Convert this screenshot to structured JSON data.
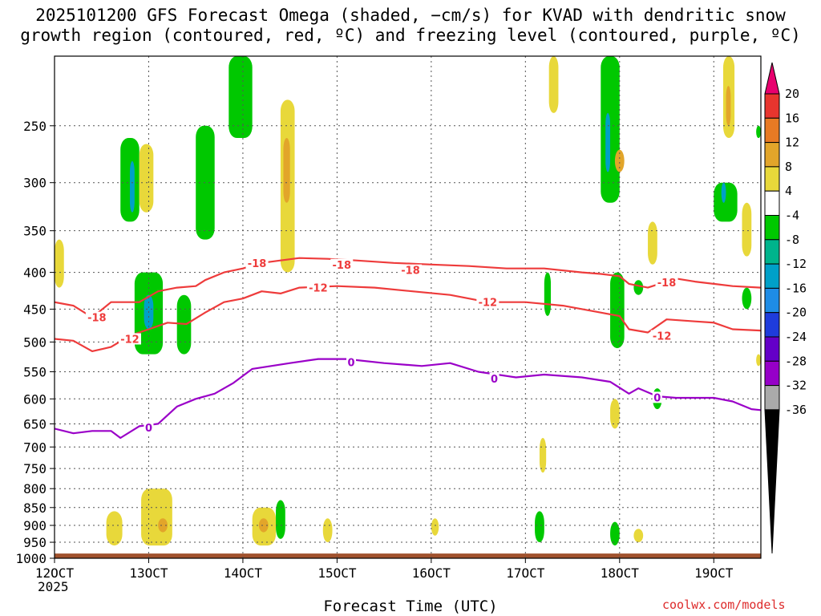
{
  "title_line1": "2025101200 GFS Forecast Omega (shaded, −cm/s) for KVAD with dendritic snow",
  "title_line2": "growth region (contoured, red, ºC) and freezing level (contoured, purple, ºC)",
  "xlabel": "Forecast Time (UTC)",
  "x_year_label": "2025",
  "credit": "coolwx.com/models",
  "chart_data": {
    "type": "time-height cross-section",
    "title": "2025101200 GFS Forecast Omega (shaded, −cm/s) for KVAD with dendritic snow growth region (contoured, red, ºC) and freezing level (contoured, purple, ºC)",
    "xlabel": "Forecast Time (UTC)",
    "ylabel": "",
    "x_ticks": [
      "12OCT",
      "13OCT",
      "14OCT",
      "15OCT",
      "16OCT",
      "17OCT",
      "18OCT",
      "19OCT"
    ],
    "x_range_days": [
      12,
      19.5
    ],
    "y_ticks": [
      250,
      300,
      350,
      400,
      450,
      500,
      550,
      600,
      650,
      700,
      750,
      800,
      850,
      900,
      950,
      1000
    ],
    "y_range_hpa": [
      200,
      1000
    ],
    "y_scale": "log-pressure (reversed)",
    "grid": true,
    "colorbar": {
      "labels": [
        20,
        16,
        12,
        8,
        4,
        -4,
        -8,
        -12,
        -16,
        -20,
        -24,
        -28,
        -32,
        -36
      ],
      "colors": [
        "#e8006e",
        "#e8352e",
        "#e87a24",
        "#e2a52a",
        "#e8d83a",
        "#ffffff",
        "#00c800",
        "#00b48c",
        "#00a0c8",
        "#1e8ce6",
        "#1e3cdc",
        "#6400c8",
        "#9600c8",
        "#aaaaaa",
        "#000000"
      ],
      "units": "−cm/s"
    },
    "contours": [
      {
        "level": -18,
        "color": "#ee3b3b",
        "points": [
          [
            12.0,
            440
          ],
          [
            12.2,
            445
          ],
          [
            12.4,
            462
          ],
          [
            12.6,
            440
          ],
          [
            12.9,
            440
          ],
          [
            13.1,
            425
          ],
          [
            13.3,
            420
          ],
          [
            13.5,
            418
          ],
          [
            13.6,
            410
          ],
          [
            13.8,
            400
          ],
          [
            14.0,
            395
          ],
          [
            14.2,
            388
          ],
          [
            14.4,
            385
          ],
          [
            14.6,
            382
          ],
          [
            14.9,
            383
          ],
          [
            15.2,
            385
          ],
          [
            15.6,
            388
          ],
          [
            16.0,
            390
          ],
          [
            16.4,
            392
          ],
          [
            16.8,
            395
          ],
          [
            17.2,
            395
          ],
          [
            17.6,
            400
          ],
          [
            17.8,
            402
          ],
          [
            18.0,
            405
          ],
          [
            18.1,
            415
          ],
          [
            18.3,
            420
          ],
          [
            18.6,
            408
          ],
          [
            18.8,
            412
          ],
          [
            19.0,
            415
          ],
          [
            19.2,
            418
          ],
          [
            19.5,
            420
          ]
        ]
      },
      {
        "level": -12,
        "color": "#ee3b3b",
        "points": [
          [
            12.0,
            495
          ],
          [
            12.2,
            498
          ],
          [
            12.4,
            515
          ],
          [
            12.6,
            508
          ],
          [
            12.8,
            490
          ],
          [
            13.0,
            480
          ],
          [
            13.2,
            470
          ],
          [
            13.4,
            472
          ],
          [
            13.6,
            455
          ],
          [
            13.8,
            440
          ],
          [
            14.0,
            435
          ],
          [
            14.2,
            425
          ],
          [
            14.4,
            428
          ],
          [
            14.6,
            420
          ],
          [
            15.0,
            418
          ],
          [
            15.4,
            420
          ],
          [
            15.8,
            425
          ],
          [
            16.2,
            430
          ],
          [
            16.6,
            440
          ],
          [
            17.0,
            440
          ],
          [
            17.4,
            445
          ],
          [
            17.8,
            455
          ],
          [
            18.0,
            460
          ],
          [
            18.1,
            480
          ],
          [
            18.3,
            485
          ],
          [
            18.5,
            465
          ],
          [
            18.8,
            468
          ],
          [
            19.0,
            470
          ],
          [
            19.2,
            480
          ],
          [
            19.5,
            482
          ]
        ]
      },
      {
        "level": 0,
        "color": "#9a00c8",
        "points": [
          [
            12.0,
            660
          ],
          [
            12.2,
            670
          ],
          [
            12.4,
            665
          ],
          [
            12.6,
            665
          ],
          [
            12.7,
            680
          ],
          [
            12.9,
            655
          ],
          [
            13.1,
            650
          ],
          [
            13.3,
            615
          ],
          [
            13.5,
            600
          ],
          [
            13.7,
            590
          ],
          [
            13.9,
            570
          ],
          [
            14.1,
            545
          ],
          [
            14.3,
            540
          ],
          [
            14.5,
            535
          ],
          [
            14.8,
            528
          ],
          [
            15.1,
            528
          ],
          [
            15.5,
            535
          ],
          [
            15.9,
            540
          ],
          [
            16.2,
            535
          ],
          [
            16.5,
            550
          ],
          [
            16.9,
            560
          ],
          [
            17.2,
            555
          ],
          [
            17.6,
            560
          ],
          [
            17.9,
            568
          ],
          [
            18.1,
            590
          ],
          [
            18.2,
            580
          ],
          [
            18.4,
            595
          ],
          [
            18.6,
            598
          ],
          [
            19.0,
            598
          ],
          [
            19.2,
            605
          ],
          [
            19.4,
            620
          ],
          [
            19.5,
            622
          ]
        ]
      }
    ],
    "contour_labels": [
      {
        "text": "-18",
        "x": 14.15,
        "p": 388
      },
      {
        "text": "-18",
        "x": 15.05,
        "p": 390
      },
      {
        "text": "-18",
        "x": 15.78,
        "p": 397
      },
      {
        "text": "-18",
        "x": 18.5,
        "p": 413
      },
      {
        "text": "-18",
        "x": 12.45,
        "p": 462
      },
      {
        "text": "-12",
        "x": 14.8,
        "p": 420
      },
      {
        "text": "-12",
        "x": 16.6,
        "p": 440
      },
      {
        "text": "-12",
        "x": 12.8,
        "p": 495
      },
      {
        "text": "-12",
        "x": 18.45,
        "p": 490
      },
      {
        "text": "0",
        "x": 15.15,
        "p": 533
      },
      {
        "text": "0",
        "x": 16.67,
        "p": 562
      },
      {
        "text": "0",
        "x": 13.0,
        "p": 658
      },
      {
        "text": "0",
        "x": 18.4,
        "p": 597
      }
    ],
    "omega_regions": [
      {
        "value": 6,
        "x": [
          12.0,
          12.1
        ],
        "p": [
          360,
          420
        ]
      },
      {
        "value": 6,
        "x": [
          12.55,
          12.72
        ],
        "p": [
          860,
          960
        ]
      },
      {
        "value": -6,
        "x": [
          12.7,
          12.9
        ],
        "p": [
          260,
          340
        ]
      },
      {
        "value": -14,
        "x": [
          12.8,
          12.85
        ],
        "p": [
          280,
          330
        ]
      },
      {
        "value": 6,
        "x": [
          12.9,
          13.05
        ],
        "p": [
          265,
          330
        ]
      },
      {
        "value": -6,
        "x": [
          12.85,
          13.15
        ],
        "p": [
          400,
          520
        ]
      },
      {
        "value": -14,
        "x": [
          12.95,
          13.05
        ],
        "p": [
          430,
          480
        ]
      },
      {
        "value": 6,
        "x": [
          12.92,
          13.25
        ],
        "p": [
          800,
          960
        ]
      },
      {
        "value": 10,
        "x": [
          13.1,
          13.2
        ],
        "p": [
          880,
          920
        ]
      },
      {
        "value": -6,
        "x": [
          13.3,
          13.45
        ],
        "p": [
          430,
          520
        ]
      },
      {
        "value": -6,
        "x": [
          13.5,
          13.7
        ],
        "p": [
          250,
          360
        ]
      },
      {
        "value": -6,
        "x": [
          13.85,
          14.1
        ],
        "p": [
          200,
          260
        ]
      },
      {
        "value": 6,
        "x": [
          14.1,
          14.35
        ],
        "p": [
          850,
          960
        ]
      },
      {
        "value": 10,
        "x": [
          14.17,
          14.27
        ],
        "p": [
          880,
          920
        ]
      },
      {
        "value": -6,
        "x": [
          14.35,
          14.45
        ],
        "p": [
          830,
          940
        ]
      },
      {
        "value": 6,
        "x": [
          14.4,
          14.55
        ],
        "p": [
          230,
          400
        ]
      },
      {
        "value": 10,
        "x": [
          14.43,
          14.5
        ],
        "p": [
          260,
          320
        ]
      },
      {
        "value": 6,
        "x": [
          14.85,
          14.95
        ],
        "p": [
          880,
          950
        ]
      },
      {
        "value": 6,
        "x": [
          16.0,
          16.08
        ],
        "p": [
          880,
          930
        ]
      },
      {
        "value": -6,
        "x": [
          17.1,
          17.2
        ],
        "p": [
          860,
          950
        ]
      },
      {
        "value": 6,
        "x": [
          17.15,
          17.22
        ],
        "p": [
          680,
          760
        ]
      },
      {
        "value": -6,
        "x": [
          17.2,
          17.27
        ],
        "p": [
          400,
          460
        ]
      },
      {
        "value": 6,
        "x": [
          17.25,
          17.35
        ],
        "p": [
          200,
          240
        ]
      },
      {
        "value": -6,
        "x": [
          17.8,
          18.0
        ],
        "p": [
          200,
          320
        ]
      },
      {
        "value": -14,
        "x": [
          17.85,
          17.9
        ],
        "p": [
          240,
          290
        ]
      },
      {
        "value": 10,
        "x": [
          17.95,
          18.05
        ],
        "p": [
          270,
          290
        ]
      },
      {
        "value": -6,
        "x": [
          17.9,
          18.05
        ],
        "p": [
          400,
          510
        ]
      },
      {
        "value": -6,
        "x": [
          17.9,
          18.0
        ],
        "p": [
          890,
          960
        ]
      },
      {
        "value": 6,
        "x": [
          17.9,
          18.0
        ],
        "p": [
          600,
          660
        ]
      },
      {
        "value": 6,
        "x": [
          18.15,
          18.25
        ],
        "p": [
          910,
          950
        ]
      },
      {
        "value": -6,
        "x": [
          18.15,
          18.25
        ],
        "p": [
          410,
          430
        ]
      },
      {
        "value": 6,
        "x": [
          18.3,
          18.4
        ],
        "p": [
          340,
          390
        ]
      },
      {
        "value": -6,
        "x": [
          18.35,
          18.45
        ],
        "p": [
          580,
          620
        ]
      },
      {
        "value": -6,
        "x": [
          19.0,
          19.25
        ],
        "p": [
          300,
          340
        ]
      },
      {
        "value": -14,
        "x": [
          19.08,
          19.13
        ],
        "p": [
          300,
          320
        ]
      },
      {
        "value": 6,
        "x": [
          19.1,
          19.22
        ],
        "p": [
          200,
          260
        ]
      },
      {
        "value": 10,
        "x": [
          19.13,
          19.18
        ],
        "p": [
          220,
          250
        ]
      },
      {
        "value": 6,
        "x": [
          19.3,
          19.4
        ],
        "p": [
          320,
          380
        ]
      },
      {
        "value": -6,
        "x": [
          19.3,
          19.4
        ],
        "p": [
          420,
          450
        ]
      },
      {
        "value": 6,
        "x": [
          19.45,
          19.5
        ],
        "p": [
          520,
          540
        ]
      },
      {
        "value": -6,
        "x": [
          19.45,
          19.5
        ],
        "p": [
          250,
          260
        ]
      }
    ],
    "surface": {
      "color": "#a0522d",
      "p": [
        985,
        1000
      ]
    }
  }
}
